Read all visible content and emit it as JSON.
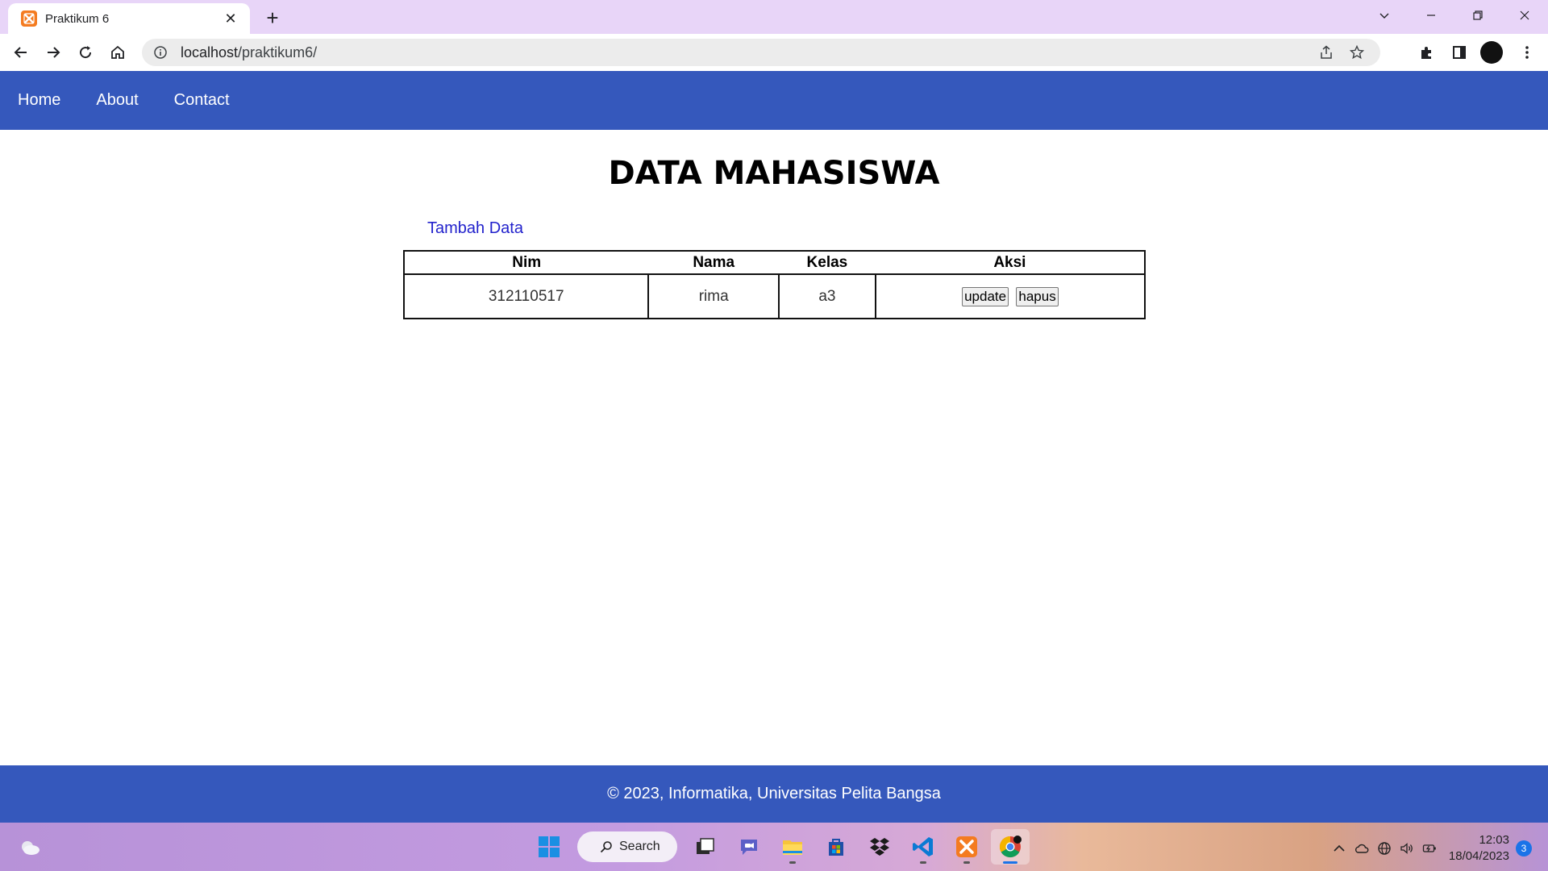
{
  "browser": {
    "tab_title": "Praktikum 6",
    "tab_close": "✕",
    "new_tab": "+",
    "url_host": "localhost",
    "url_path": "/praktikum6/"
  },
  "nav": {
    "links": [
      "Home",
      "About",
      "Contact"
    ]
  },
  "page": {
    "title": "DATA MAHASISWA",
    "add_link": "Tambah Data"
  },
  "table": {
    "headers": [
      "Nim",
      "Nama",
      "Kelas",
      "Aksi"
    ],
    "rows": [
      {
        "nim": "312110517",
        "nama": "rima",
        "kelas": "a3",
        "update_label": "update",
        "hapus_label": "hapus"
      }
    ]
  },
  "footer": {
    "text": "© 2023, Informatika, Universitas Pelita Bangsa"
  },
  "taskbar": {
    "search_label": "Search",
    "time": "12:03",
    "date": "18/04/2023",
    "notification_count": "3"
  }
}
